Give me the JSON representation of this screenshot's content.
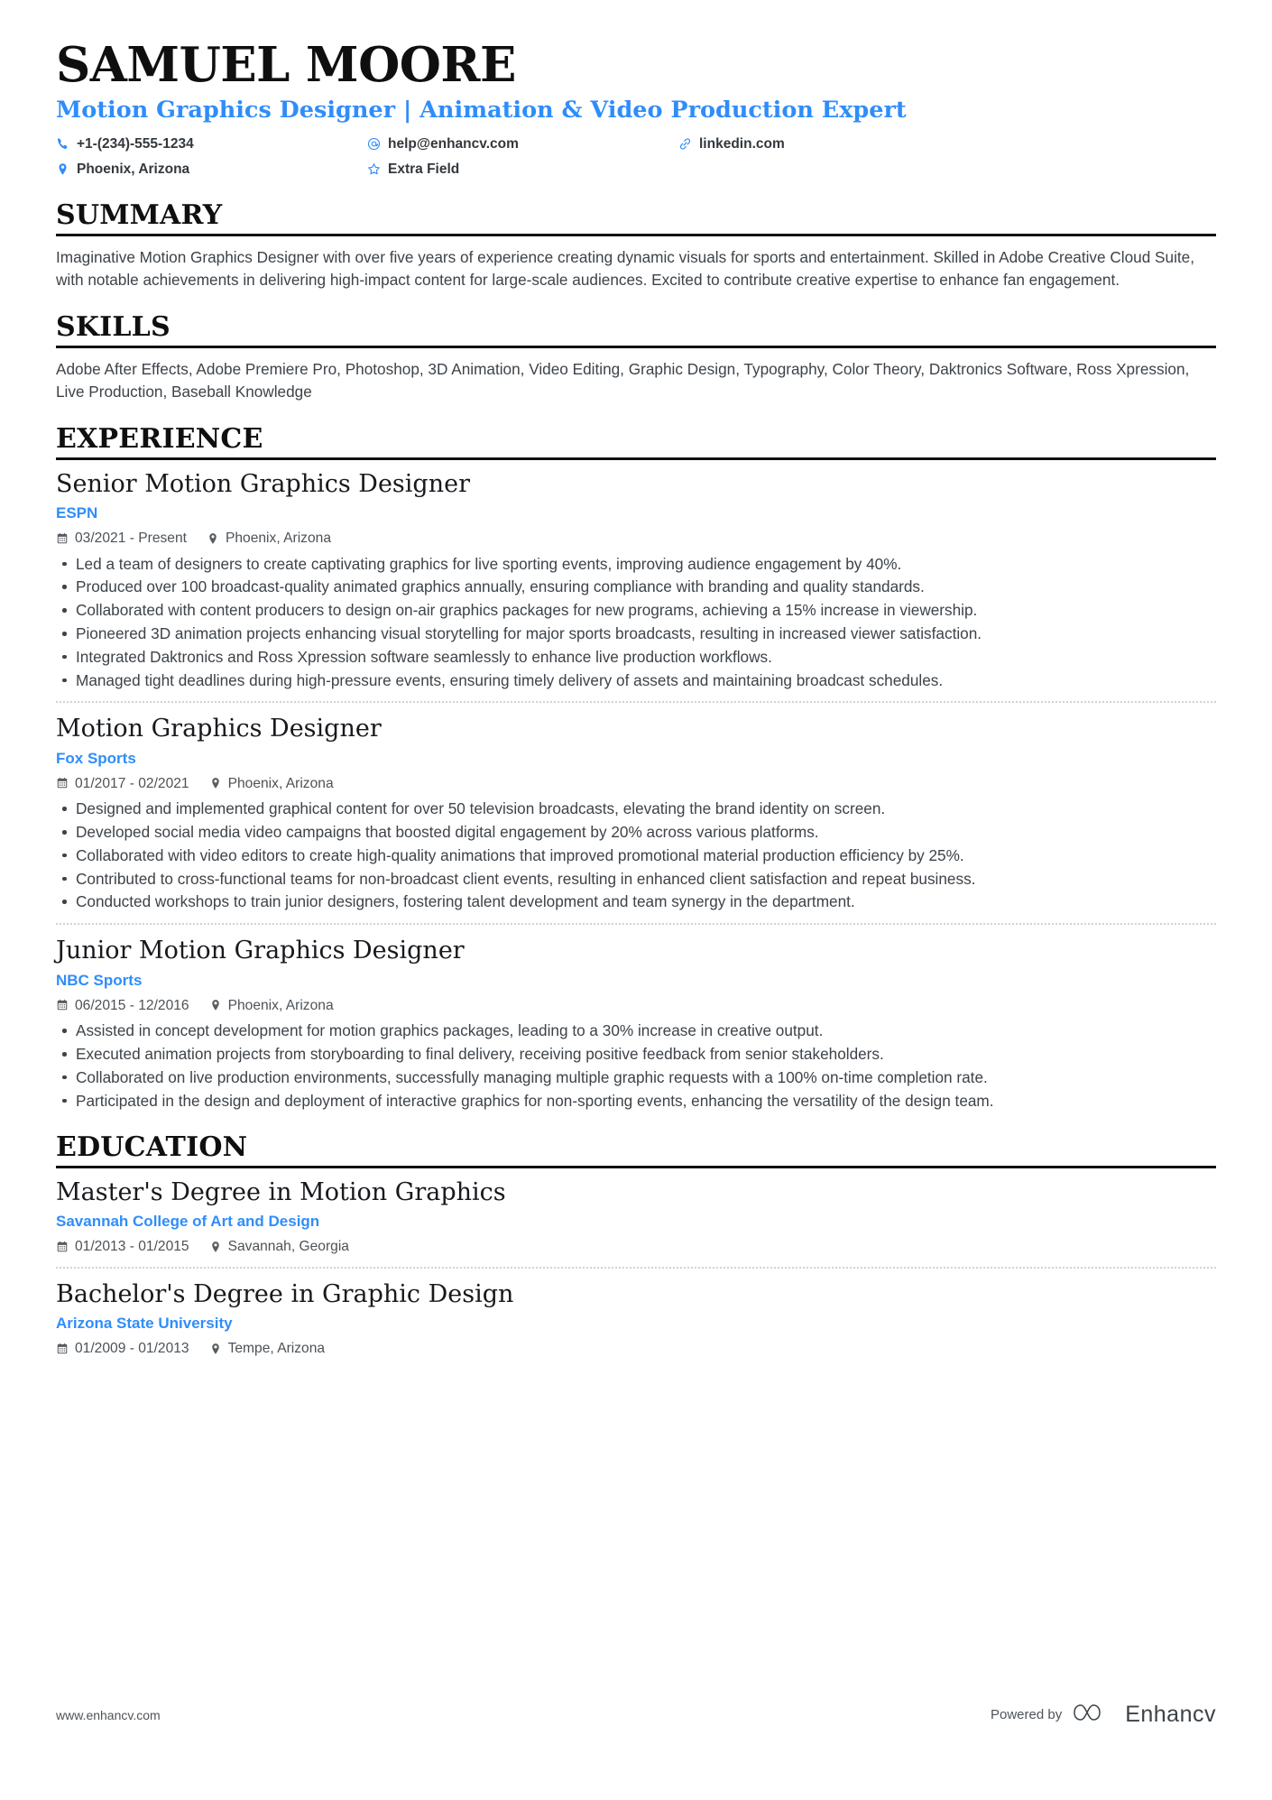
{
  "header": {
    "name": "SAMUEL MOORE",
    "headline": "Motion Graphics Designer | Animation & Video Production Expert",
    "contacts": [
      {
        "icon": "phone-icon",
        "text": "+1-(234)-555-1234"
      },
      {
        "icon": "email-icon",
        "text": "help@enhancv.com"
      },
      {
        "icon": "link-icon",
        "text": "linkedin.com"
      },
      {
        "icon": "location-pin-icon",
        "text": "Phoenix, Arizona"
      },
      {
        "icon": "star-icon",
        "text": "Extra Field"
      }
    ]
  },
  "sections": {
    "summary": {
      "title": "SUMMARY",
      "text": "Imaginative Motion Graphics Designer with over five years of experience creating dynamic visuals for sports and entertainment. Skilled in Adobe Creative Cloud Suite, with notable achievements in delivering high-impact content for large-scale audiences. Excited to contribute creative expertise to enhance fan engagement."
    },
    "skills": {
      "title": "SKILLS",
      "text": "Adobe After Effects, Adobe Premiere Pro, Photoshop, 3D Animation, Video Editing, Graphic Design, Typography, Color Theory, Daktronics Software, Ross Xpression, Live Production, Baseball Knowledge"
    },
    "experience": {
      "title": "EXPERIENCE",
      "entries": [
        {
          "title": "Senior Motion Graphics Designer",
          "org": "ESPN",
          "dates": "03/2021 - Present",
          "location": "Phoenix, Arizona",
          "bullets": [
            "Led a team of designers to create captivating graphics for live sporting events, improving audience engagement by 40%.",
            "Produced over 100 broadcast-quality animated graphics annually, ensuring compliance with branding and quality standards.",
            "Collaborated with content producers to design on-air graphics packages for new programs, achieving a 15% increase in viewership.",
            "Pioneered 3D animation projects enhancing visual storytelling for major sports broadcasts, resulting in increased viewer satisfaction.",
            "Integrated Daktronics and Ross Xpression software seamlessly to enhance live production workflows.",
            "Managed tight deadlines during high-pressure events, ensuring timely delivery of assets and maintaining broadcast schedules."
          ]
        },
        {
          "title": "Motion Graphics Designer",
          "org": "Fox Sports",
          "dates": "01/2017 - 02/2021",
          "location": "Phoenix, Arizona",
          "bullets": [
            "Designed and implemented graphical content for over 50 television broadcasts, elevating the brand identity on screen.",
            "Developed social media video campaigns that boosted digital engagement by 20% across various platforms.",
            "Collaborated with video editors to create high-quality animations that improved promotional material production efficiency by 25%.",
            "Contributed to cross-functional teams for non-broadcast client events, resulting in enhanced client satisfaction and repeat business.",
            "Conducted workshops to train junior designers, fostering talent development and team synergy in the department."
          ]
        },
        {
          "title": "Junior Motion Graphics Designer",
          "org": "NBC Sports",
          "dates": "06/2015 - 12/2016",
          "location": "Phoenix, Arizona",
          "bullets": [
            "Assisted in concept development for motion graphics packages, leading to a 30% increase in creative output.",
            "Executed animation projects from storyboarding to final delivery, receiving positive feedback from senior stakeholders.",
            "Collaborated on live production environments, successfully managing multiple graphic requests with a 100% on-time completion rate.",
            "Participated in the design and deployment of interactive graphics for non-sporting events, enhancing the versatility of the design team."
          ]
        }
      ]
    },
    "education": {
      "title": "EDUCATION",
      "entries": [
        {
          "title": "Master's Degree in Motion Graphics",
          "org": "Savannah College of Art and Design",
          "dates": "01/2013 - 01/2015",
          "location": "Savannah, Georgia"
        },
        {
          "title": "Bachelor's Degree in Graphic Design",
          "org": "Arizona State University",
          "dates": "01/2009 - 01/2013",
          "location": "Tempe, Arizona"
        }
      ]
    }
  },
  "footer": {
    "url": "www.enhancv.com",
    "powered_by": "Powered by",
    "brand": "Enhancv"
  },
  "colors": {
    "accent": "#2f8dfa",
    "text": "#3d4349",
    "heading": "#0f0f0f"
  }
}
